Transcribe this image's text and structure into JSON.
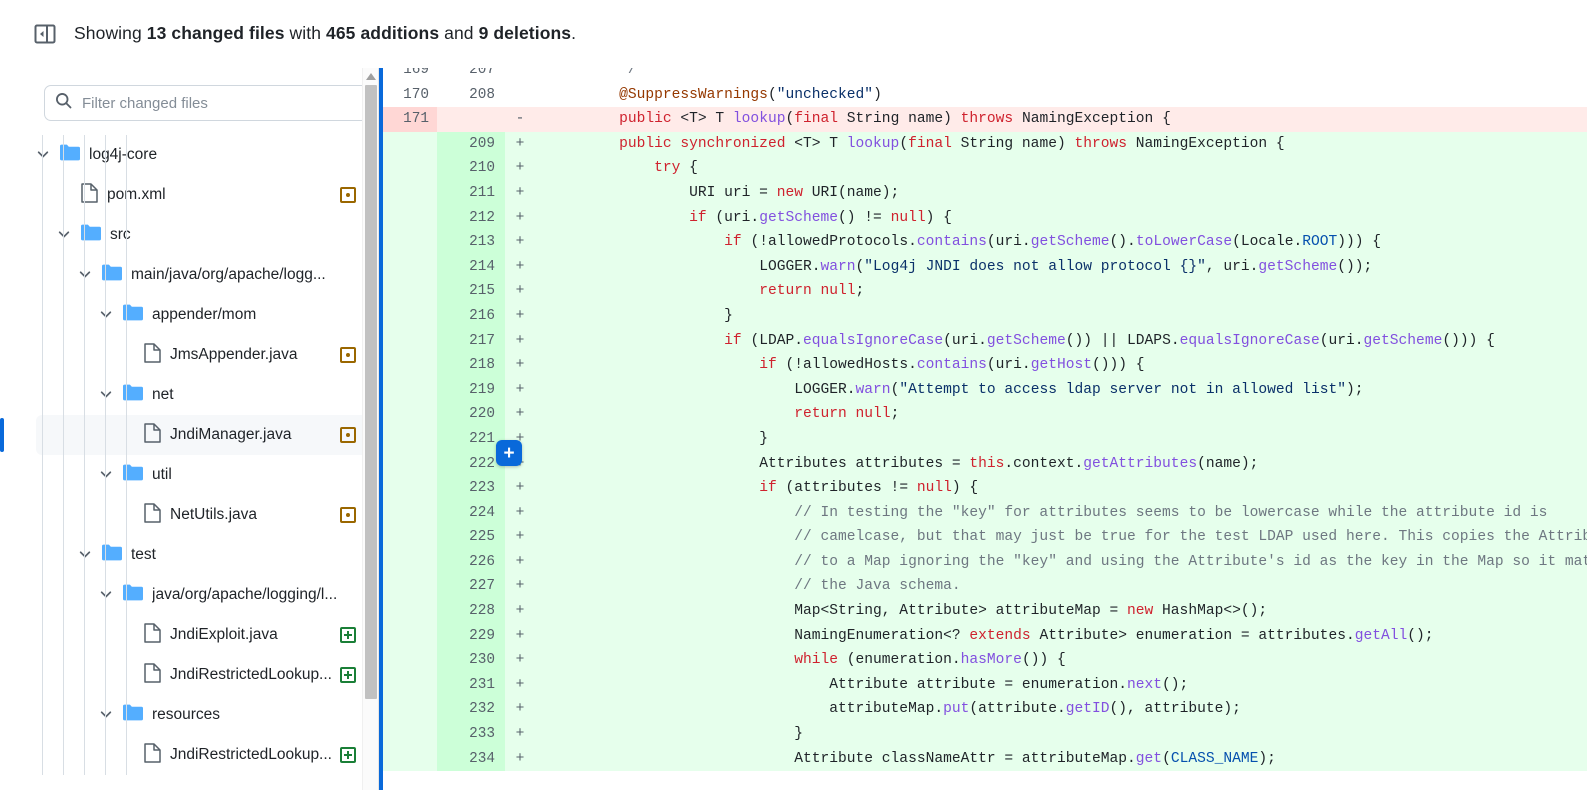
{
  "header": {
    "collapse_icon": "sidebar-collapse-icon",
    "prefix": "Showing ",
    "changed_files": "13 changed files",
    "mid": " with ",
    "additions": "465 additions",
    "and": " and ",
    "deletions": "9 deletions",
    "suffix": "."
  },
  "sidebar": {
    "search_icon": "search-icon",
    "filter_placeholder": "Filter changed files",
    "filter_value": "",
    "tree": [
      {
        "label": "log4j-core",
        "type": "folder",
        "depth": 0,
        "expanded": true,
        "status": null
      },
      {
        "label": "pom.xml",
        "type": "file",
        "depth": 1,
        "expanded": false,
        "status": "modified"
      },
      {
        "label": "src",
        "type": "folder",
        "depth": 1,
        "expanded": true,
        "status": null
      },
      {
        "label": "main/java/org/apache/logg...",
        "type": "folder",
        "depth": 2,
        "expanded": true,
        "status": null
      },
      {
        "label": "appender/mom",
        "type": "folder",
        "depth": 3,
        "expanded": true,
        "status": null
      },
      {
        "label": "JmsAppender.java",
        "type": "file",
        "depth": 4,
        "expanded": false,
        "status": "modified"
      },
      {
        "label": "net",
        "type": "folder",
        "depth": 3,
        "expanded": true,
        "status": null
      },
      {
        "label": "JndiManager.java",
        "type": "file",
        "depth": 4,
        "expanded": false,
        "status": "modified",
        "selected": true
      },
      {
        "label": "util",
        "type": "folder",
        "depth": 3,
        "expanded": true,
        "status": null
      },
      {
        "label": "NetUtils.java",
        "type": "file",
        "depth": 4,
        "expanded": false,
        "status": "modified"
      },
      {
        "label": "test",
        "type": "folder",
        "depth": 2,
        "expanded": true,
        "status": null
      },
      {
        "label": "java/org/apache/logging/l...",
        "type": "folder",
        "depth": 3,
        "expanded": true,
        "status": null
      },
      {
        "label": "JndiExploit.java",
        "type": "file",
        "depth": 4,
        "expanded": false,
        "status": "added"
      },
      {
        "label": "JndiRestrictedLookup...",
        "type": "file",
        "depth": 4,
        "expanded": false,
        "status": "added"
      },
      {
        "label": "resources",
        "type": "folder",
        "depth": 3,
        "expanded": true,
        "status": null
      },
      {
        "label": "JndiRestrictedLookup...",
        "type": "file",
        "depth": 4,
        "expanded": false,
        "status": "added"
      }
    ],
    "scrollbar": {
      "up_arrow_icon": "scroll-up-arrow-icon"
    }
  },
  "diff": {
    "add_comment_button_label": "+",
    "lines": [
      {
        "old": "169",
        "new": "207",
        "mark": "",
        "kind": "ctx",
        "partial": true,
        "tokens": [
          {
            "t": "*/",
            "c": "c",
            "indent": 8
          }
        ]
      },
      {
        "old": "170",
        "new": "208",
        "mark": "",
        "kind": "ctx",
        "tokens": [
          {
            "t": "@SuppressWarnings",
            "c": "an",
            "indent": 8
          },
          {
            "t": "(",
            "c": "p"
          },
          {
            "t": "\"unchecked\"",
            "c": "s"
          },
          {
            "t": ")",
            "c": "p"
          }
        ]
      },
      {
        "old": "171",
        "new": "",
        "mark": "-",
        "kind": "del",
        "tokens": [
          {
            "t": "public ",
            "c": "k",
            "indent": 8
          },
          {
            "t": "<T> T ",
            "c": "p"
          },
          {
            "t": "lookup",
            "c": "fn"
          },
          {
            "t": "(",
            "c": "p"
          },
          {
            "t": "final ",
            "c": "k"
          },
          {
            "t": "String name) ",
            "c": "p"
          },
          {
            "t": "throws ",
            "c": "k"
          },
          {
            "t": "NamingException {",
            "c": "p"
          }
        ]
      },
      {
        "old": "",
        "new": "209",
        "mark": "+",
        "kind": "add",
        "tokens": [
          {
            "t": "public synchronized ",
            "c": "k",
            "indent": 8
          },
          {
            "t": "<T> T ",
            "c": "p"
          },
          {
            "t": "lookup",
            "c": "fn"
          },
          {
            "t": "(",
            "c": "p"
          },
          {
            "t": "final ",
            "c": "k"
          },
          {
            "t": "String name) ",
            "c": "p"
          },
          {
            "t": "throws ",
            "c": "k"
          },
          {
            "t": "NamingException {",
            "c": "p"
          }
        ]
      },
      {
        "old": "",
        "new": "210",
        "mark": "+",
        "kind": "add",
        "tokens": [
          {
            "t": "try ",
            "c": "k",
            "indent": 12
          },
          {
            "t": "{",
            "c": "p"
          }
        ]
      },
      {
        "old": "",
        "new": "211",
        "mark": "+",
        "kind": "add",
        "tokens": [
          {
            "t": "URI uri = ",
            "c": "p",
            "indent": 16
          },
          {
            "t": "new ",
            "c": "k"
          },
          {
            "t": "URI(name);",
            "c": "p"
          }
        ]
      },
      {
        "old": "",
        "new": "212",
        "mark": "+",
        "kind": "add",
        "tokens": [
          {
            "t": "if ",
            "c": "k",
            "indent": 16
          },
          {
            "t": "(uri.",
            "c": "p"
          },
          {
            "t": "getScheme",
            "c": "fn"
          },
          {
            "t": "() != ",
            "c": "p"
          },
          {
            "t": "null",
            "c": "k"
          },
          {
            "t": ") {",
            "c": "p"
          }
        ]
      },
      {
        "old": "",
        "new": "213",
        "mark": "+",
        "kind": "add",
        "tokens": [
          {
            "t": "if ",
            "c": "k",
            "indent": 20
          },
          {
            "t": "(!allowedProtocols.",
            "c": "p"
          },
          {
            "t": "contains",
            "c": "fn"
          },
          {
            "t": "(uri.",
            "c": "p"
          },
          {
            "t": "getScheme",
            "c": "fn"
          },
          {
            "t": "().",
            "c": "p"
          },
          {
            "t": "toLowerCase",
            "c": "fn"
          },
          {
            "t": "(Locale.",
            "c": "p"
          },
          {
            "t": "ROOT",
            "c": "t"
          },
          {
            "t": "))) {",
            "c": "p"
          }
        ]
      },
      {
        "old": "",
        "new": "214",
        "mark": "+",
        "kind": "add",
        "tokens": [
          {
            "t": "LOGGER.",
            "c": "p",
            "indent": 24
          },
          {
            "t": "warn",
            "c": "fn"
          },
          {
            "t": "(",
            "c": "p"
          },
          {
            "t": "\"Log4j JNDI does not allow protocol {}\"",
            "c": "s"
          },
          {
            "t": ", uri.",
            "c": "p"
          },
          {
            "t": "getScheme",
            "c": "fn"
          },
          {
            "t": "());",
            "c": "p"
          }
        ]
      },
      {
        "old": "",
        "new": "215",
        "mark": "+",
        "kind": "add",
        "tokens": [
          {
            "t": "return ",
            "c": "k",
            "indent": 24
          },
          {
            "t": "null",
            "c": "k"
          },
          {
            "t": ";",
            "c": "p"
          }
        ]
      },
      {
        "old": "",
        "new": "216",
        "mark": "+",
        "kind": "add",
        "tokens": [
          {
            "t": "}",
            "c": "p",
            "indent": 20
          }
        ]
      },
      {
        "old": "",
        "new": "217",
        "mark": "+",
        "kind": "add",
        "tokens": [
          {
            "t": "if ",
            "c": "k",
            "indent": 20
          },
          {
            "t": "(LDAP.",
            "c": "p"
          },
          {
            "t": "equalsIgnoreCase",
            "c": "fn"
          },
          {
            "t": "(uri.",
            "c": "p"
          },
          {
            "t": "getScheme",
            "c": "fn"
          },
          {
            "t": "()) || LDAPS.",
            "c": "p"
          },
          {
            "t": "equalsIgnoreCase",
            "c": "fn"
          },
          {
            "t": "(uri.",
            "c": "p"
          },
          {
            "t": "getScheme",
            "c": "fn"
          },
          {
            "t": "())) {",
            "c": "p"
          }
        ]
      },
      {
        "old": "",
        "new": "218",
        "mark": "+",
        "kind": "add",
        "tokens": [
          {
            "t": "if ",
            "c": "k",
            "indent": 24
          },
          {
            "t": "(!allowedHosts.",
            "c": "p"
          },
          {
            "t": "contains",
            "c": "fn"
          },
          {
            "t": "(uri.",
            "c": "p"
          },
          {
            "t": "getHost",
            "c": "fn"
          },
          {
            "t": "())) {",
            "c": "p"
          }
        ]
      },
      {
        "old": "",
        "new": "219",
        "mark": "+",
        "kind": "add",
        "tokens": [
          {
            "t": "LOGGER.",
            "c": "p",
            "indent": 28
          },
          {
            "t": "warn",
            "c": "fn"
          },
          {
            "t": "(",
            "c": "p"
          },
          {
            "t": "\"Attempt to access ldap server not in allowed list\"",
            "c": "s"
          },
          {
            "t": ");",
            "c": "p"
          }
        ]
      },
      {
        "old": "",
        "new": "220",
        "mark": "+",
        "kind": "add",
        "tokens": [
          {
            "t": "return ",
            "c": "k",
            "indent": 28
          },
          {
            "t": "null",
            "c": "k"
          },
          {
            "t": ";",
            "c": "p"
          }
        ]
      },
      {
        "old": "",
        "new": "221",
        "mark": "+",
        "kind": "add",
        "has_add_button": true,
        "tokens": [
          {
            "t": "}",
            "c": "p",
            "indent": 24
          }
        ]
      },
      {
        "old": "",
        "new": "222",
        "mark": "+",
        "kind": "add",
        "tokens": [
          {
            "t": "Attributes attributes = ",
            "c": "p",
            "indent": 24
          },
          {
            "t": "this",
            "c": "k"
          },
          {
            "t": ".context.",
            "c": "p"
          },
          {
            "t": "getAttributes",
            "c": "fn"
          },
          {
            "t": "(name);",
            "c": "p"
          }
        ]
      },
      {
        "old": "",
        "new": "223",
        "mark": "+",
        "kind": "add",
        "tokens": [
          {
            "t": "if ",
            "c": "k",
            "indent": 24
          },
          {
            "t": "(attributes != ",
            "c": "p"
          },
          {
            "t": "null",
            "c": "k"
          },
          {
            "t": ") {",
            "c": "p"
          }
        ]
      },
      {
        "old": "",
        "new": "224",
        "mark": "+",
        "kind": "add",
        "tokens": [
          {
            "t": "// In testing the \"key\" for attributes seems to be lowercase while the attribute id is",
            "c": "c",
            "indent": 28
          }
        ]
      },
      {
        "old": "",
        "new": "225",
        "mark": "+",
        "kind": "add",
        "tokens": [
          {
            "t": "// camelcase, but that may just be true for the test LDAP used here. This copies the Attributes",
            "c": "c",
            "indent": 28
          }
        ]
      },
      {
        "old": "",
        "new": "226",
        "mark": "+",
        "kind": "add",
        "tokens": [
          {
            "t": "// to a Map ignoring the \"key\" and using the Attribute's id as the key in the Map so it matches",
            "c": "c",
            "indent": 28
          }
        ]
      },
      {
        "old": "",
        "new": "227",
        "mark": "+",
        "kind": "add",
        "tokens": [
          {
            "t": "// the Java schema.",
            "c": "c",
            "indent": 28
          }
        ]
      },
      {
        "old": "",
        "new": "228",
        "mark": "+",
        "kind": "add",
        "tokens": [
          {
            "t": "Map<String, Attribute> attributeMap = ",
            "c": "p",
            "indent": 28
          },
          {
            "t": "new ",
            "c": "k"
          },
          {
            "t": "HashMap<>();",
            "c": "p"
          }
        ]
      },
      {
        "old": "",
        "new": "229",
        "mark": "+",
        "kind": "add",
        "tokens": [
          {
            "t": "NamingEnumeration<? ",
            "c": "p",
            "indent": 28
          },
          {
            "t": "extends ",
            "c": "k"
          },
          {
            "t": "Attribute> enumeration = attributes.",
            "c": "p"
          },
          {
            "t": "getAll",
            "c": "fn"
          },
          {
            "t": "();",
            "c": "p"
          }
        ]
      },
      {
        "old": "",
        "new": "230",
        "mark": "+",
        "kind": "add",
        "tokens": [
          {
            "t": "while ",
            "c": "k",
            "indent": 28
          },
          {
            "t": "(enumeration.",
            "c": "p"
          },
          {
            "t": "hasMore",
            "c": "fn"
          },
          {
            "t": "()) {",
            "c": "p"
          }
        ]
      },
      {
        "old": "",
        "new": "231",
        "mark": "+",
        "kind": "add",
        "tokens": [
          {
            "t": "Attribute attribute = enumeration.",
            "c": "p",
            "indent": 32
          },
          {
            "t": "next",
            "c": "fn"
          },
          {
            "t": "();",
            "c": "p"
          }
        ]
      },
      {
        "old": "",
        "new": "232",
        "mark": "+",
        "kind": "add",
        "tokens": [
          {
            "t": "attributeMap.",
            "c": "p",
            "indent": 32
          },
          {
            "t": "put",
            "c": "fn"
          },
          {
            "t": "(attribute.",
            "c": "p"
          },
          {
            "t": "getID",
            "c": "fn"
          },
          {
            "t": "(), attribute);",
            "c": "p"
          }
        ]
      },
      {
        "old": "",
        "new": "233",
        "mark": "+",
        "kind": "add",
        "tokens": [
          {
            "t": "}",
            "c": "p",
            "indent": 28
          }
        ]
      },
      {
        "old": "",
        "new": "234",
        "mark": "+",
        "kind": "add",
        "tokens": [
          {
            "t": "Attribute classNameAttr = attributeMap.",
            "c": "p",
            "indent": 28
          },
          {
            "t": "get",
            "c": "fn"
          },
          {
            "t": "(",
            "c": "p"
          },
          {
            "t": "CLASS_NAME",
            "c": "t"
          },
          {
            "t": ");",
            "c": "p"
          }
        ]
      }
    ]
  }
}
